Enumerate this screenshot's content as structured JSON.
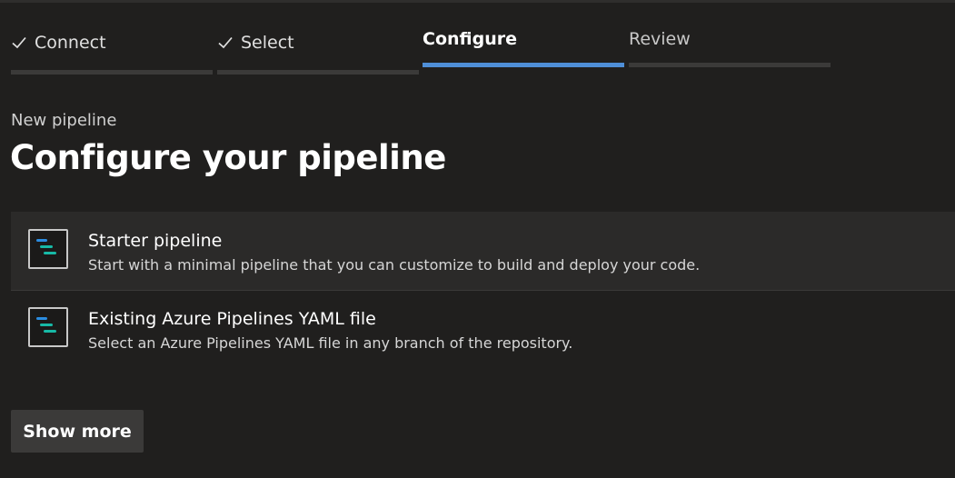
{
  "colors": {
    "background": "#201f1e",
    "accent": "#4f8fd8",
    "step_bar_inactive": "#3b3a39",
    "icon_blue": "#2b8ce0",
    "icon_teal": "#17b9a6"
  },
  "stepper": {
    "steps": [
      {
        "label": "Connect",
        "state": "completed",
        "icon": "check-icon"
      },
      {
        "label": "Select",
        "state": "completed",
        "icon": "check-icon"
      },
      {
        "label": "Configure",
        "state": "active"
      },
      {
        "label": "Review",
        "state": "upcoming"
      }
    ]
  },
  "header": {
    "subtitle": "New pipeline",
    "title": "Configure your pipeline"
  },
  "options": [
    {
      "title": "Starter pipeline",
      "description": "Start with a minimal pipeline that you can customize to build and deploy your code.",
      "icon": "pipeline-yaml-icon",
      "selected": true
    },
    {
      "title": "Existing Azure Pipelines YAML file",
      "description": "Select an Azure Pipelines YAML file in any branch of the repository.",
      "icon": "pipeline-yaml-icon",
      "selected": false
    }
  ],
  "show_more_label": "Show more"
}
